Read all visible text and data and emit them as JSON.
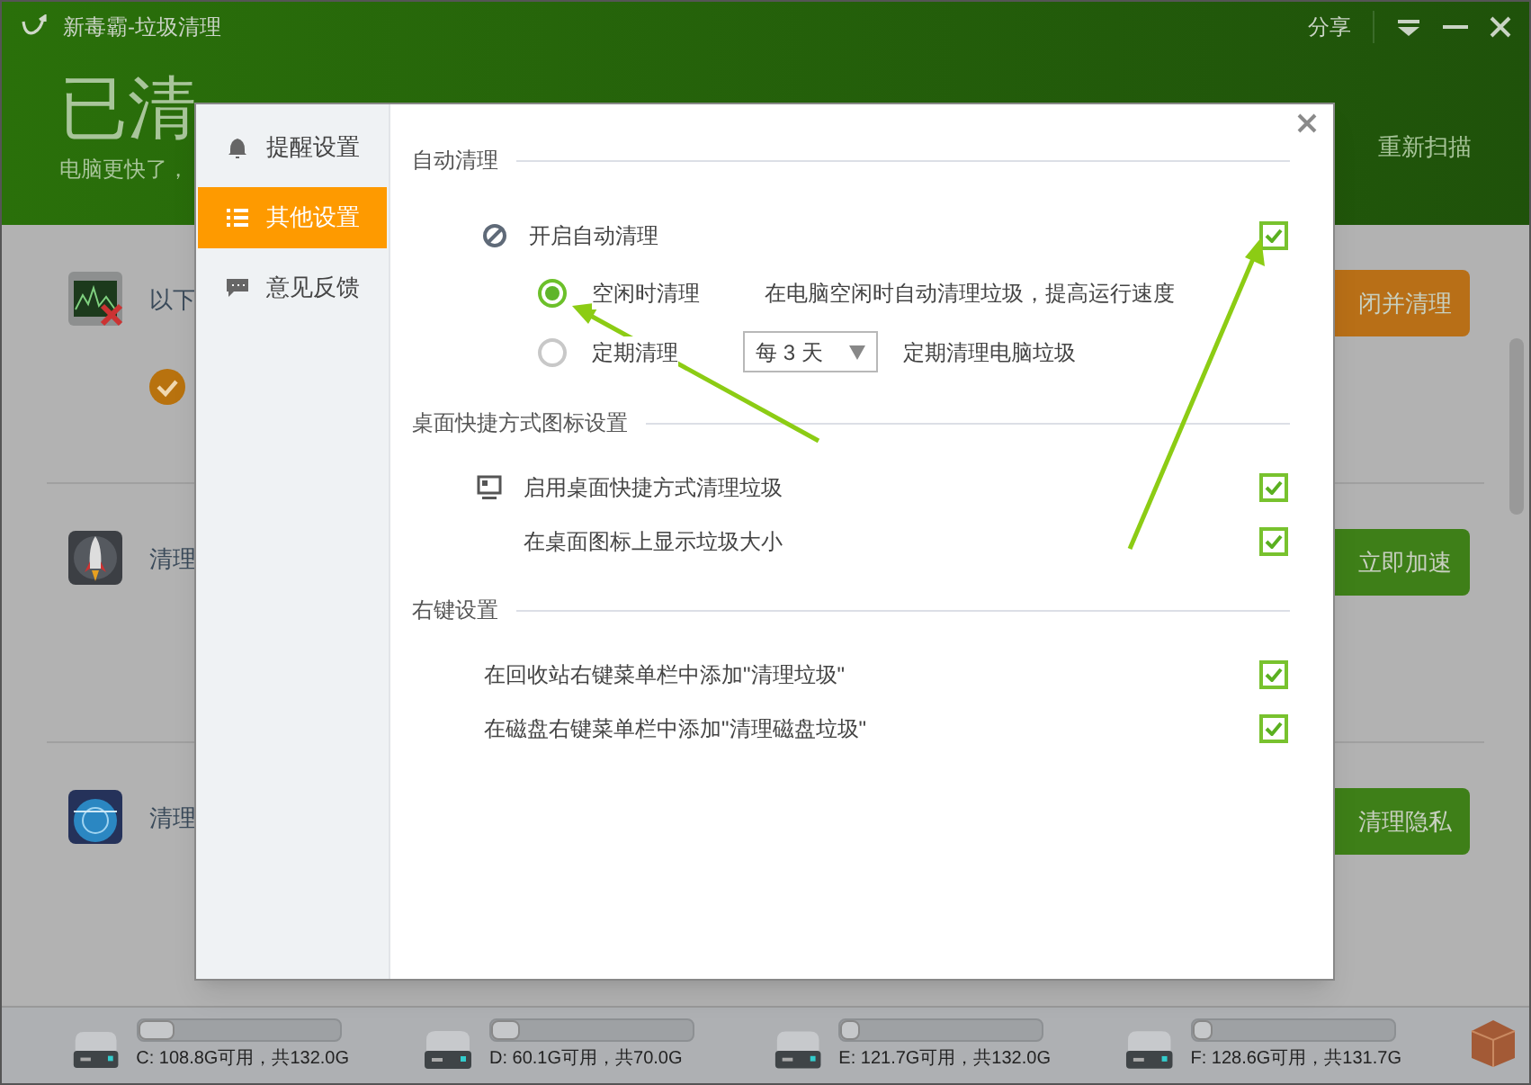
{
  "window": {
    "title": "新毒霸-垃圾清理",
    "share": "分享"
  },
  "header": {
    "headline": "已清",
    "subtitle": "电脑更快了，",
    "rescan": "重新扫描"
  },
  "items": [
    {
      "kind": "monitor",
      "label": "以下",
      "button": "闭并清理",
      "color": "#b86f17",
      "done": true
    },
    {
      "kind": "rocket",
      "label": "清理",
      "button": "立即加速",
      "color": "#3e7f18",
      "done": false
    },
    {
      "kind": "radar",
      "label": "清理",
      "button": "清理隐私",
      "color": "#3e7f18",
      "done": false
    }
  ],
  "disks": [
    {
      "label": "C: 108.8G可用，共132.0G",
      "level": 0.18
    },
    {
      "label": "D: 60.1G可用，共70.0G",
      "level": 0.14
    },
    {
      "label": "E: 121.7G可用，共132.0G",
      "level": 0.08
    },
    {
      "label": "F: 128.6G可用，共131.7G",
      "level": 0.03
    }
  ],
  "dialog": {
    "sidebar": [
      {
        "label": "提醒设置",
        "selected": false
      },
      {
        "label": "其他设置",
        "selected": true
      },
      {
        "label": "意见反馈",
        "selected": false
      }
    ],
    "sections": [
      {
        "title": "自动清理",
        "rows": [
          {
            "kind": "checkbox",
            "label": "开启自动清理",
            "checked": true
          },
          {
            "kind": "radio",
            "label": "空闲时清理",
            "selected": true,
            "description": "在电脑空闲时自动清理垃圾，提高运行速度"
          },
          {
            "kind": "radio",
            "label": "定期清理",
            "selected": false,
            "dropdown": "每 3 天",
            "description": "定期清理电脑垃圾"
          }
        ]
      },
      {
        "title": "桌面快捷方式图标设置",
        "rows": [
          {
            "kind": "checkbox",
            "label": "启用桌面快捷方式清理垃圾",
            "checked": true
          },
          {
            "kind": "checkbox",
            "label": "在桌面图标上显示垃圾大小",
            "checked": true
          }
        ]
      },
      {
        "title": "右键设置",
        "rows": [
          {
            "kind": "checkbox",
            "label": "在回收站右键菜单栏中添加\"清理垃圾\"",
            "checked": true
          },
          {
            "kind": "checkbox",
            "label": "在磁盘右键菜单栏中添加\"清理磁盘垃圾\"",
            "checked": true
          }
        ]
      }
    ]
  }
}
